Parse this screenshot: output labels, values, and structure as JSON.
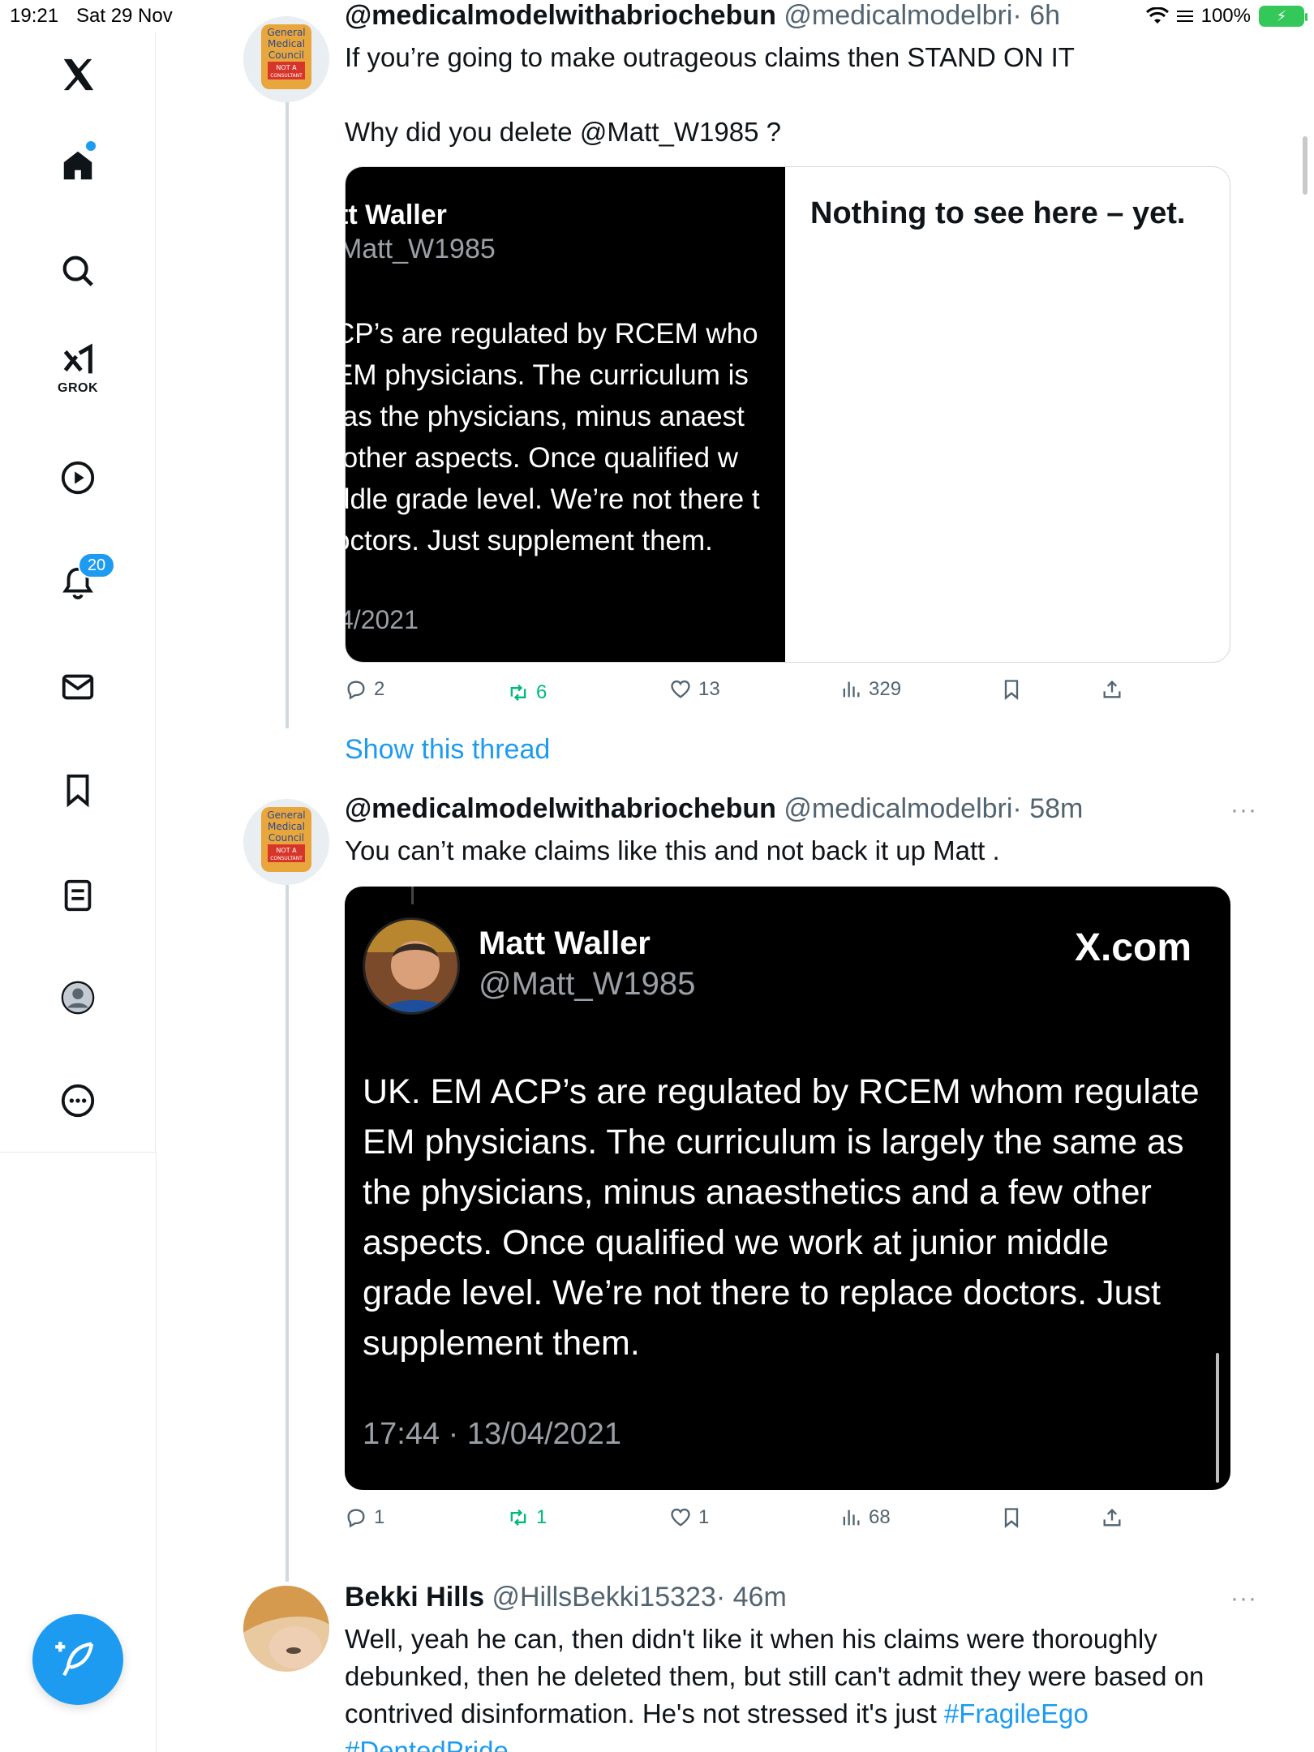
{
  "status_bar": {
    "time": "19:21",
    "date": "Sat 29 Nov",
    "battery": "100%"
  },
  "sidebar": {
    "items": [
      {
        "name": "x-logo-icon"
      },
      {
        "name": "home-icon"
      },
      {
        "name": "search-icon"
      },
      {
        "name": "grok-icon",
        "label": "GROK"
      },
      {
        "name": "video-icon"
      },
      {
        "name": "notifications-icon",
        "badge": "20"
      },
      {
        "name": "messages-icon"
      },
      {
        "name": "bookmarks-icon"
      },
      {
        "name": "lists-icon"
      },
      {
        "name": "profile-icon"
      },
      {
        "name": "more-icon"
      }
    ]
  },
  "tweets": [
    {
      "name": "@medicalmodelwithabriochebun",
      "handle": "@medicalmodelbri",
      "time": "· 6h",
      "text_line1": "If you’re going to make outrageous claims then STAND ON IT",
      "text_line2": "Why did you delete @Matt_W1985 ?",
      "card": {
        "left_name": "tt Waller",
        "left_handle": "Matt_W1985",
        "left_body": "CP’s are regulated by RCEM who\nEM physicians. The curriculum is\n as the physicians, minus anaest\n other aspects. Once qualified w\nddle grade level. We’re not there t\noctors. Just supplement them.",
        "left_timestamp": "4/2021",
        "right_message": "Nothing to see here – yet."
      },
      "actions": {
        "replies": "2",
        "reposts": "6",
        "likes": "13",
        "views": "329"
      }
    },
    {
      "name": "@medicalmodelwithabriochebun",
      "handle": "@medicalmodelbri",
      "time": "· 58m",
      "text": "You can’t make claims like this and not back it up Matt .",
      "card": {
        "name": "Matt Waller",
        "handle": "@Matt_W1985",
        "brand": "X.com",
        "body": "UK. EM ACP’s are regulated by RCEM whom regulate EM physicians. The curriculum is largely the same as the physicians, minus anaesthetics and a few other aspects. Once qualified we work at junior middle grade level. We’re not there to replace doctors. Just supplement them.",
        "timestamp": "17:44 · 13/04/2021"
      },
      "actions": {
        "replies": "1",
        "reposts": "1",
        "likes": "1",
        "views": "68"
      }
    },
    {
      "name": "Bekki Hills",
      "handle": "@HillsBekki15323",
      "time": "· 46m",
      "text": "Well, yeah he can, then didn't like it when his claims were thoroughly debunked, then he deleted them, but still can't admit they were based on contrived disinformation. He's not stressed it's just ",
      "hashtag1": "#FragileEgo",
      "hashtag2": "#DentedPride"
    }
  ],
  "show_thread": "Show this thread",
  "more": "···",
  "gmc_avatar_text": [
    "General",
    "Medical",
    "Council",
    "NOT A",
    "CONSULTANT"
  ],
  "colors": {
    "accent": "#1d9bf0",
    "repost_green": "#00ba7c",
    "muted": "#536471"
  }
}
